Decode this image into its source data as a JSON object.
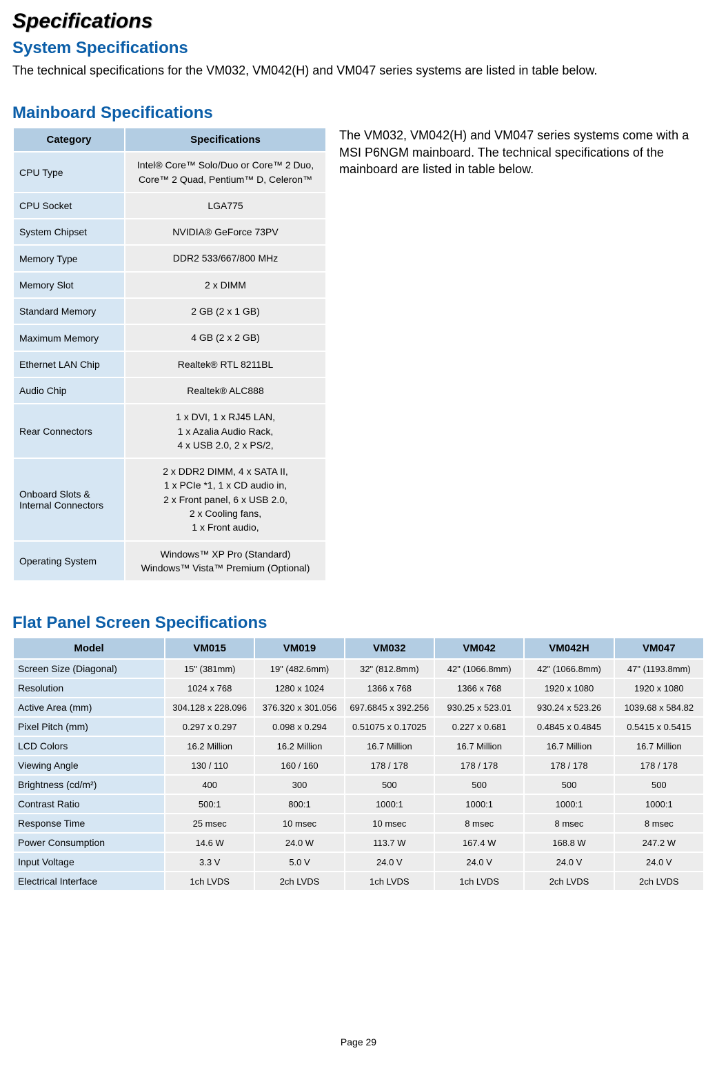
{
  "title": "Specifications",
  "section1": {
    "heading": "System Specifications",
    "body": "The technical specifications for the VM032, VM042(H) and VM047 series systems are listed in table below."
  },
  "section2": {
    "heading": "Mainboard Specifications",
    "side_text": "The VM032, VM042(H) and VM047 series systems come with a MSI P6NGM mainboard. The technical specifications of the mainboard are listed in table below.",
    "col_headers": {
      "cat": "Category",
      "spec": "Specifications"
    },
    "rows": [
      {
        "cat": "CPU Type",
        "val": "Intel® Core™ Solo/Duo or Core™ 2 Duo, Core™ 2 Quad, Pentium™ D, Celeron™"
      },
      {
        "cat": "CPU Socket",
        "val": "LGA775"
      },
      {
        "cat": "System Chipset",
        "val": "NVIDIA® GeForce 73PV"
      },
      {
        "cat": "Memory Type",
        "val": "DDR2 533/667/800 MHz"
      },
      {
        "cat": "Memory Slot",
        "val": "2 x DIMM"
      },
      {
        "cat": "Standard Memory",
        "val": "2 GB (2 x 1 GB)"
      },
      {
        "cat": "Maximum Memory",
        "val": "4 GB (2 x 2 GB)"
      },
      {
        "cat": "Ethernet LAN Chip",
        "val": "Realtek® RTL 8211BL"
      },
      {
        "cat": "Audio Chip",
        "val": "Realtek® ALC888"
      },
      {
        "cat": "Rear Connectors",
        "val": "1 x DVI, 1 x RJ45 LAN,\n1 x Azalia Audio Rack,\n4 x USB 2.0, 2 x PS/2,"
      },
      {
        "cat": "Onboard Slots & Internal Connectors",
        "val": "2 x DDR2 DIMM, 4 x SATA II,\n1 x PCIe *1, 1 x CD audio in,\n2 x Front panel, 6 x USB 2.0,\n2 x Cooling fans,\n1 x Front audio,"
      },
      {
        "cat": "Operating System",
        "val": "Windows™ XP Pro (Standard)\nWindows™ Vista™ Premium (Optional)"
      }
    ]
  },
  "section3": {
    "heading": "Flat Panel Screen Specifications",
    "model_header": "Model",
    "models": [
      "VM015",
      "VM019",
      "VM032",
      "VM042",
      "VM042H",
      "VM047"
    ],
    "row_labels": [
      "Screen Size (Diagonal)",
      "Resolution",
      "Active Area (mm)",
      "Pixel Pitch (mm)",
      "LCD Colors",
      "Viewing Angle",
      "Brightness (cd/m²)",
      "Contrast Ratio",
      "Response Time",
      "Power Consumption",
      "Input Voltage",
      "Electrical Interface"
    ],
    "data": [
      [
        "15\" (381mm)",
        "19\" (482.6mm)",
        "32\" (812.8mm)",
        "42\" (1066.8mm)",
        "42\" (1066.8mm)",
        "47\" (1193.8mm)"
      ],
      [
        "1024 x 768",
        "1280 x 1024",
        "1366 x 768",
        "1366 x 768",
        "1920 x 1080",
        "1920 x 1080"
      ],
      [
        "304.128 x 228.096",
        "376.320 x 301.056",
        "697.6845 x 392.256",
        "930.25 x 523.01",
        "930.24 x 523.26",
        "1039.68 x 584.82"
      ],
      [
        "0.297 x 0.297",
        "0.098 x 0.294",
        "0.51075 x 0.17025",
        "0.227 x 0.681",
        "0.4845 x 0.4845",
        "0.5415 x 0.5415"
      ],
      [
        "16.2 Million",
        "16.2 Million",
        "16.7 Million",
        "16.7 Million",
        "16.7 Million",
        "16.7 Million"
      ],
      [
        "130 / 110",
        "160 / 160",
        "178 / 178",
        "178 / 178",
        "178 / 178",
        "178 / 178"
      ],
      [
        "400",
        "300",
        "500",
        "500",
        "500",
        "500"
      ],
      [
        "500:1",
        "800:1",
        "1000:1",
        "1000:1",
        "1000:1",
        "1000:1"
      ],
      [
        "25 msec",
        "10 msec",
        "10 msec",
        "8 msec",
        "8 msec",
        "8 msec"
      ],
      [
        "14.6 W",
        "24.0 W",
        "113.7 W",
        "167.4 W",
        "168.8 W",
        "247.2 W"
      ],
      [
        "3.3 V",
        "5.0 V",
        "24.0 V",
        "24.0 V",
        "24.0 V",
        "24.0 V"
      ],
      [
        "1ch LVDS",
        "2ch LVDS",
        "1ch LVDS",
        "1ch LVDS",
        "2ch LVDS",
        "2ch LVDS"
      ]
    ]
  },
  "page_number": "Page 29"
}
